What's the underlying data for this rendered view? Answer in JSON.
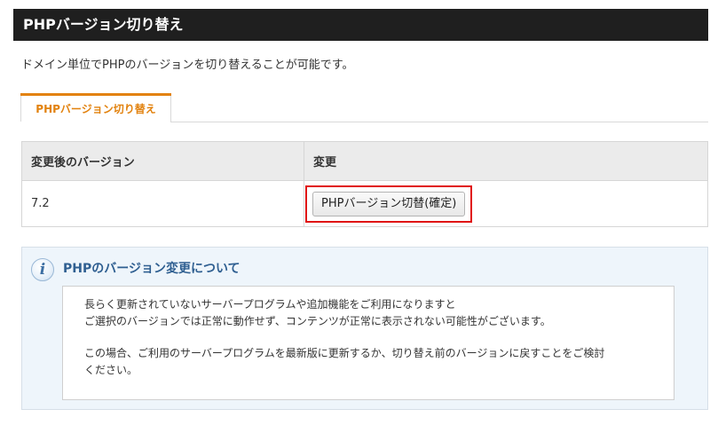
{
  "header": {
    "title": "PHPバージョン切り替え"
  },
  "description": "ドメイン単位でPHPのバージョンを切り替えることが可能です。",
  "tab": {
    "label": "PHPバージョン切り替え"
  },
  "table": {
    "headers": [
      "変更後のバージョン",
      "変更"
    ],
    "rows": [
      {
        "version": "7.2",
        "button_label": "PHPバージョン切替(確定)"
      }
    ]
  },
  "info": {
    "icon": "info-icon",
    "icon_glyph": "i",
    "title": "PHPのバージョン変更について",
    "paragraphs": [
      {
        "lines": [
          "長らく更新されていないサーバープログラムや追加機能をご利用になりますと",
          "ご選択のバージョンでは正常に動作せず、コンテンツが正常に表示されない可能性がございます。"
        ]
      },
      {
        "lines": [
          "この場合、ご利用のサーバープログラムを最新版に更新するか、切り替え前のバージョンに戻すことをご検討",
          "ください。"
        ]
      }
    ]
  },
  "colors": {
    "header_bg": "#1f1f1f",
    "tab_accent": "#e2820e",
    "highlight_border": "#e01010",
    "info_title": "#2f5f91",
    "info_bg": "#eef5fb"
  }
}
